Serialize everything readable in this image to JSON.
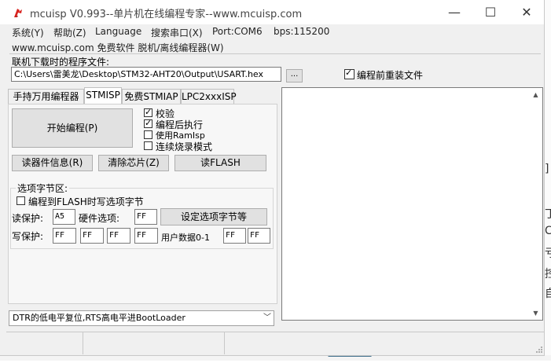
{
  "window": {
    "title": "mcuisp V0.993--单片机在线编程专家--www.mcuisp.com",
    "minimize_glyph": "—",
    "maximize_glyph": "☐",
    "close_glyph": "✕"
  },
  "menu": [
    "系统(Y)",
    "帮助(Z)",
    "Language",
    "搜索串口(X)",
    "Port:COM6",
    "bps:115200"
  ],
  "subline": "www.mcuisp.com 免费软件 脱机/离线编程器(W)",
  "file": {
    "label": "联机下载时的程序文件:",
    "path": "C:\\Users\\雷美龙\\Desktop\\STM32-AHT20\\Output\\USART.hex",
    "browse_label": "...",
    "reload_label": "编程前重装文件",
    "reload_checked": true
  },
  "tabs": [
    "手持万用编程器",
    "STMISP",
    "免费STMIAP",
    "LPC2xxxISP"
  ],
  "active_tab": 1,
  "stmisp": {
    "start_button": "开始编程(P)",
    "options": [
      {
        "label": "校验",
        "checked": true
      },
      {
        "label": "编程后执行",
        "checked": true
      },
      {
        "label": "使用RamIsp",
        "checked": false
      },
      {
        "label": "连续烧录模式",
        "checked": false
      }
    ],
    "read_info_button": "读器件信息(R)",
    "erase_button": "清除芯片(Z)",
    "read_flash_button": "读FLASH",
    "option_bytes": {
      "group_title": "选项字节区:",
      "write_option_label": "编程到FLASH时写选项字节",
      "write_option_checked": false,
      "read_protect_label": "读保护:",
      "read_protect_value": "A5",
      "hw_option_label": "硬件选项:",
      "hw_option_value": "FF",
      "set_button": "设定选项字节等",
      "write_protect_label": "写保护:",
      "write_protect_values": [
        "FF",
        "FF",
        "FF",
        "FF"
      ],
      "user_data_label": "用户数据0-1",
      "user_data_values": [
        "FF",
        "FF"
      ]
    },
    "boot_mode": "DTR的低电平复位,RTS高电平进BootLoader"
  },
  "background_glyphs": [
    "]",
    "丁",
    "C",
    "亏",
    "控",
    "自"
  ]
}
